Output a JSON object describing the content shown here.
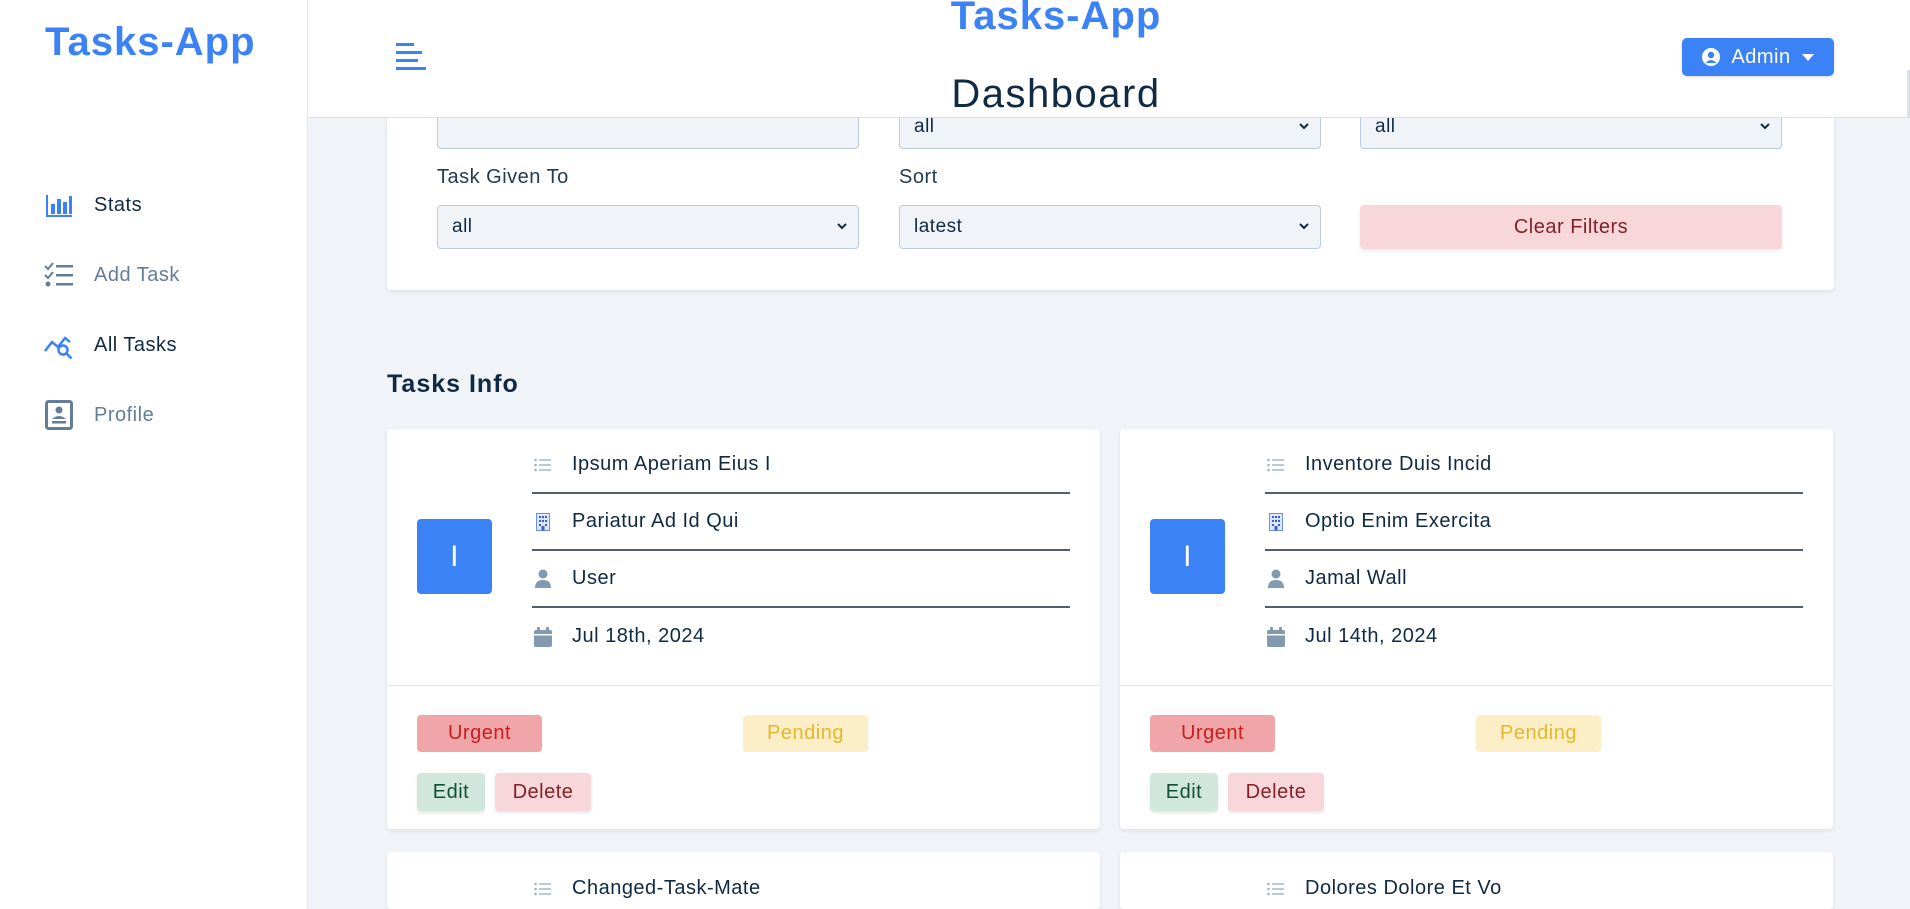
{
  "sidebar": {
    "logo": "Tasks-App",
    "items": [
      {
        "label": "Stats",
        "icon": "bar-chart-icon"
      },
      {
        "label": "Add Task",
        "icon": "task-list-icon"
      },
      {
        "label": "All Tasks",
        "icon": "chart-search-icon"
      },
      {
        "label": "Profile",
        "icon": "profile-card-icon"
      }
    ]
  },
  "header": {
    "brand": "Tasks-App",
    "page_title": "Dashboard",
    "user_button": "Admin"
  },
  "filters": {
    "search_value": "",
    "select_1_value": "all",
    "select_2_value": "all",
    "task_given_to_label": "Task Given To",
    "task_given_to_value": "all",
    "sort_label": "Sort",
    "sort_value": "latest",
    "clear_label": "Clear Filters"
  },
  "tasks_section": {
    "title": "Tasks Info",
    "cards": [
      {
        "initial": "I",
        "title": "Ipsum Aperiam Eius I",
        "company": "Pariatur Ad Id Qui",
        "assignee": "User",
        "date": "Jul 18th, 2024",
        "priority": "Urgent",
        "status": "Pending",
        "edit_label": "Edit",
        "delete_label": "Delete"
      },
      {
        "initial": "I",
        "title": "Inventore Duis Incid",
        "company": "Optio Enim Exercita",
        "assignee": "Jamal Wall",
        "date": "Jul 14th, 2024",
        "priority": "Urgent",
        "status": "Pending",
        "edit_label": "Edit",
        "delete_label": "Delete"
      },
      {
        "title": "Changed-Task-Mate"
      },
      {
        "title": "Dolores Dolore Et Vo"
      }
    ]
  },
  "colors": {
    "accent": "#3b82f6",
    "background": "#f0f4f8",
    "urgent_bg": "#f0a5a8",
    "pending_bg": "#fcefc7"
  }
}
